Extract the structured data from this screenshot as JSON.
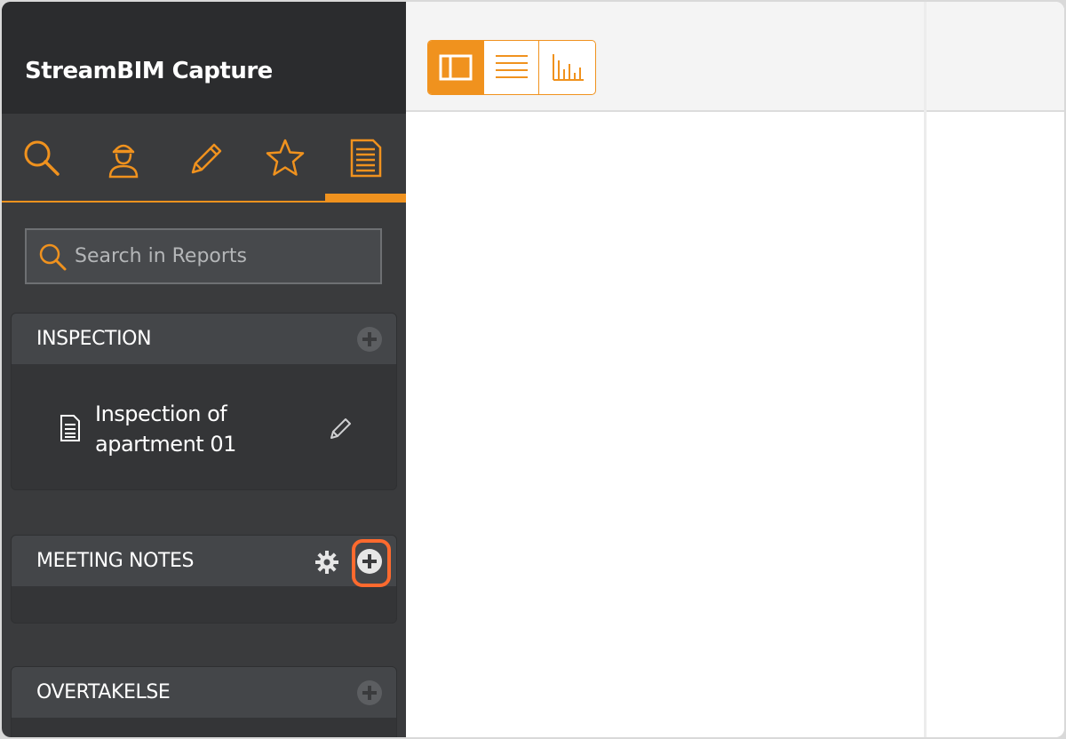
{
  "app": {
    "title": "StreamBIM Capture"
  },
  "nav": {
    "tabs": [
      {
        "name": "search",
        "icon": "search-icon"
      },
      {
        "name": "people",
        "icon": "worker-icon"
      },
      {
        "name": "annotate",
        "icon": "pencil-icon"
      },
      {
        "name": "favorites",
        "icon": "star-icon"
      },
      {
        "name": "reports",
        "icon": "document-icon",
        "active": true
      }
    ]
  },
  "search": {
    "placeholder": "Search in Reports",
    "value": ""
  },
  "sections": [
    {
      "title": "INSPECTION",
      "items": [
        {
          "name": "Inspection of apartment 01"
        }
      ]
    },
    {
      "title": "MEETING NOTES",
      "items": []
    },
    {
      "title": "OVERTAKELSE",
      "items": []
    }
  ],
  "toolbar": {
    "views": [
      {
        "name": "split-view",
        "icon": "panel-icon",
        "active": true
      },
      {
        "name": "list-view",
        "icon": "lines-icon",
        "active": false
      },
      {
        "name": "chart-view",
        "icon": "bar-chart-icon",
        "active": false
      }
    ]
  },
  "colors": {
    "accent": "#f0921e",
    "sidebar": "#3a3b3d",
    "header": "#2b2c2e",
    "highlight": "#ff6a2e"
  }
}
